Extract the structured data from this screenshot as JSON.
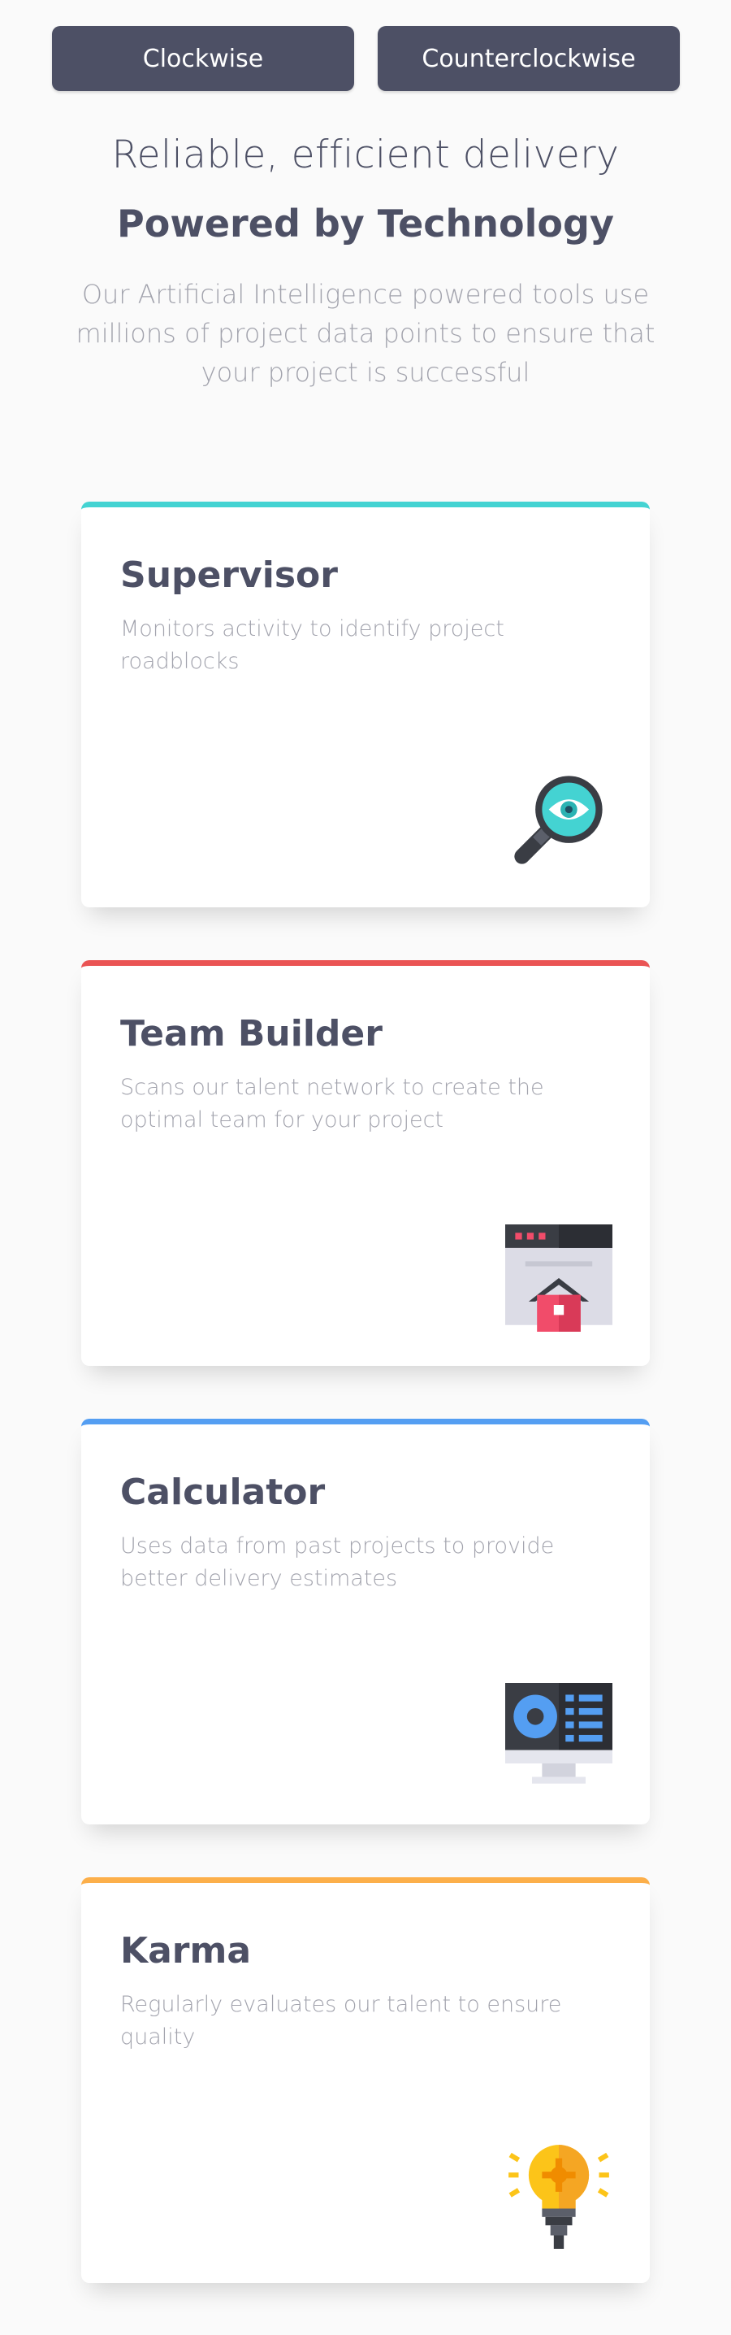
{
  "buttons": {
    "clockwise": "Clockwise",
    "counterclockwise": "Counterclockwise"
  },
  "header": {
    "subtitle": "Reliable, efficient delivery",
    "title": "Powered by Technology",
    "description": "Our Artificial Intelligence powered tools use millions of project data points to ensure that your project is successful"
  },
  "cards": [
    {
      "title": "Supervisor",
      "description": "Monitors activity to identify project roadblocks",
      "accent": "#44d3d2",
      "icon": "magnifier-eye-icon"
    },
    {
      "title": "Team Builder",
      "description": "Scans our talent network to create the optimal team for your project",
      "accent": "#ea5454",
      "icon": "browser-house-icon"
    },
    {
      "title": "Calculator",
      "description": "Uses data from past projects to provide better delivery estimates",
      "accent": "#549ef2",
      "icon": "monitor-chart-icon"
    },
    {
      "title": "Karma",
      "description": "Regularly evaluates our talent to ensure quality",
      "accent": "#fcaf4a",
      "icon": "lightbulb-icon"
    }
  ]
}
